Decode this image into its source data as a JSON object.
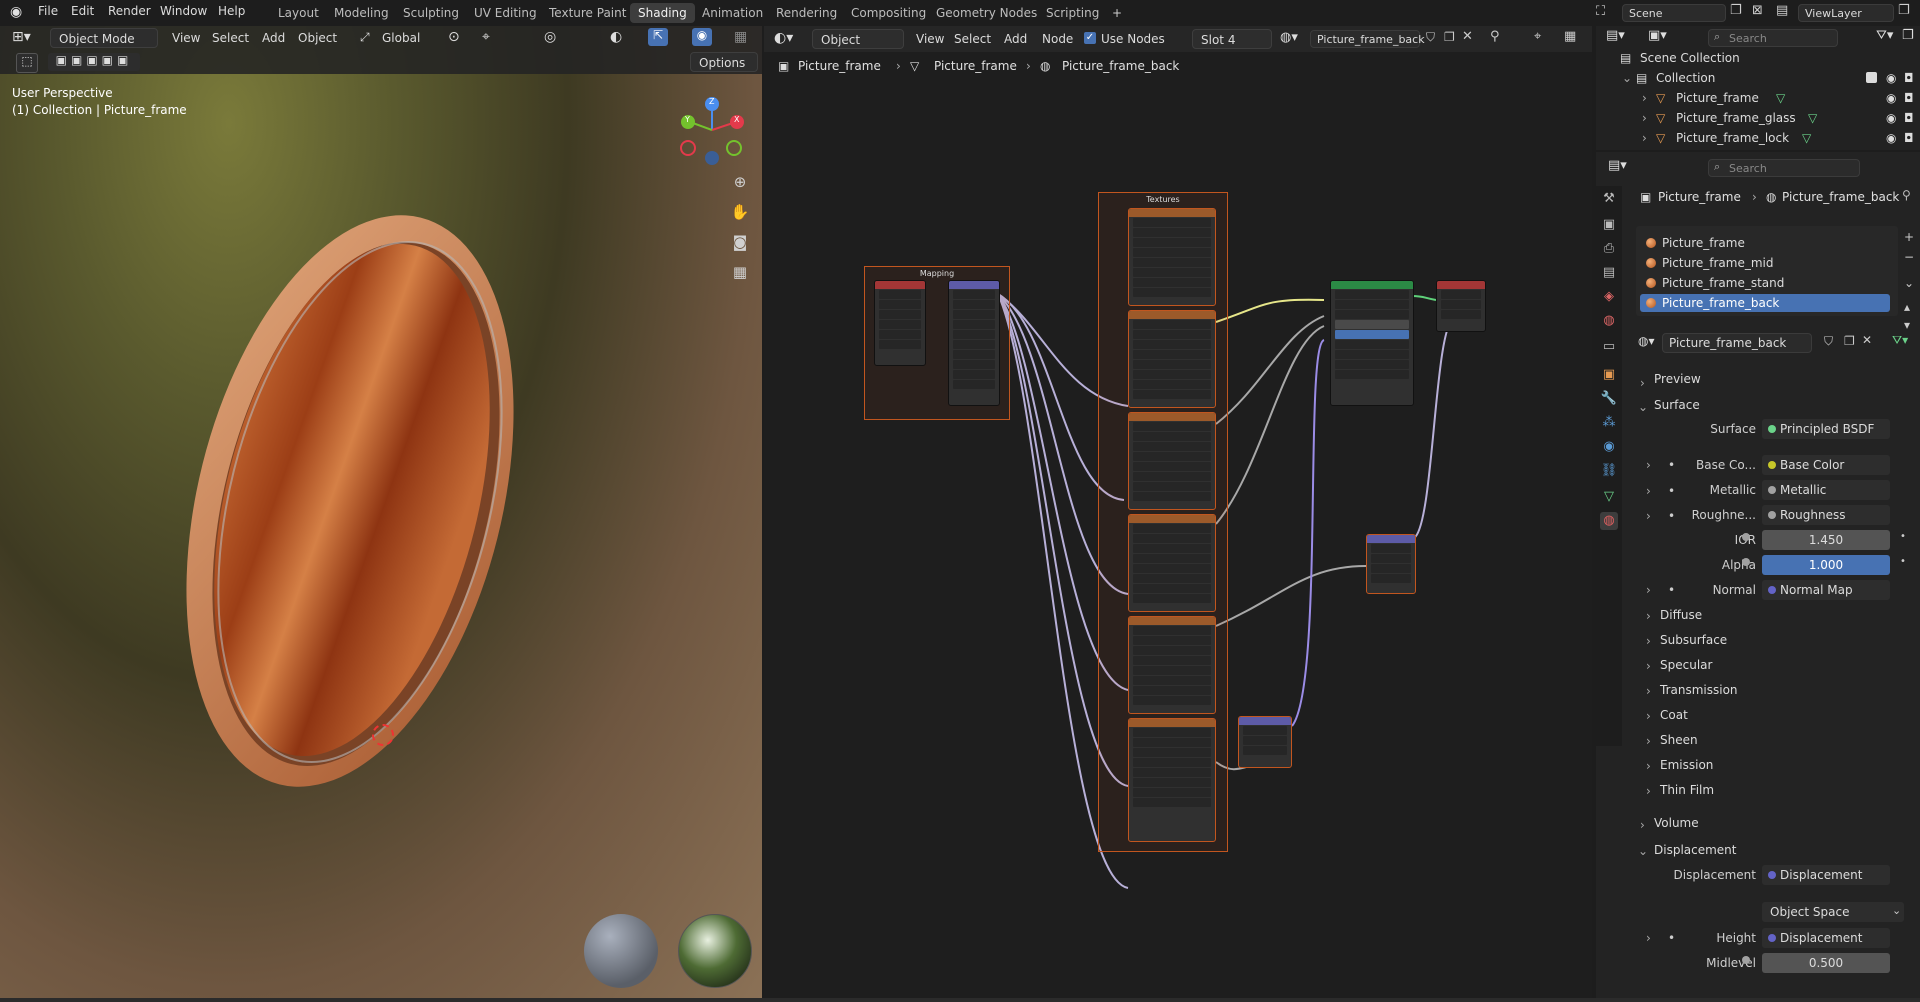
{
  "topbar": {
    "menus": [
      "File",
      "Edit",
      "Render",
      "Window",
      "Help"
    ],
    "workspaces": [
      "Layout",
      "Modeling",
      "Sculpting",
      "UV Editing",
      "Texture Paint",
      "Shading",
      "Animation",
      "Rendering",
      "Compositing",
      "Geometry Nodes",
      "Scripting"
    ],
    "active_workspace": "Shading",
    "add_tab": "+",
    "scene": "Scene",
    "view_layer": "ViewLayer"
  },
  "viewport": {
    "mode": "Object Mode",
    "menus": [
      "View",
      "Select",
      "Add",
      "Object"
    ],
    "orientation": "Global",
    "options": "Options",
    "perspective_label": "User Perspective",
    "collection_label": "(1) Collection | Picture_frame",
    "gizmo": {
      "z": "Z",
      "y": "Y",
      "x": "X"
    }
  },
  "node_editor": {
    "object_type": "Object",
    "menus": [
      "View",
      "Select",
      "Add",
      "Node"
    ],
    "use_nodes": "Use Nodes",
    "slot": "Slot 4",
    "material": "Picture_frame_back",
    "breadcrumb": [
      "Picture_frame",
      "Picture_frame",
      "Picture_frame_back"
    ],
    "frames": {
      "mapping": "Mapping",
      "textures": "Textures"
    }
  },
  "outliner": {
    "search_placeholder": "Search",
    "scene_collection": "Scene Collection",
    "collection": "Collection",
    "objects": [
      "Picture_frame",
      "Picture_frame_glass",
      "Picture_frame_lock"
    ]
  },
  "properties": {
    "search_placeholder": "Search",
    "breadcrumb_object": "Picture_frame",
    "breadcrumb_material": "Picture_frame_back",
    "materials": [
      "Picture_frame",
      "Picture_frame_mid",
      "Picture_frame_stand",
      "Picture_frame_back"
    ],
    "selected_material": "Picture_frame_back",
    "material_name": "Picture_frame_back",
    "preview": "Preview",
    "surface_section": "Surface",
    "surface_label": "Surface",
    "surface_value": "Principled BSDF",
    "inputs": [
      {
        "label": "Base Co...",
        "value": "Base Color",
        "color": "#c7c729"
      },
      {
        "label": "Metallic",
        "value": "Metallic",
        "color": "#a1a1a1"
      },
      {
        "label": "Roughne...",
        "value": "Roughness",
        "color": "#a1a1a1"
      }
    ],
    "ior_label": "IOR",
    "ior": "1.450",
    "alpha_label": "Alpha",
    "alpha": "1.000",
    "normal_label": "Normal",
    "normal_value": "Normal Map",
    "subsections": [
      "Diffuse",
      "Subsurface",
      "Specular",
      "Transmission",
      "Coat",
      "Sheen",
      "Emission",
      "Thin Film"
    ],
    "volume": "Volume",
    "displacement_section": "Displacement",
    "displacement_label": "Displacement",
    "displacement_value": "Displacement",
    "space": "Object Space",
    "height_label": "Height",
    "height_value": "Displacement",
    "midlevel_label": "Midlevel",
    "midlevel": "0.500"
  }
}
